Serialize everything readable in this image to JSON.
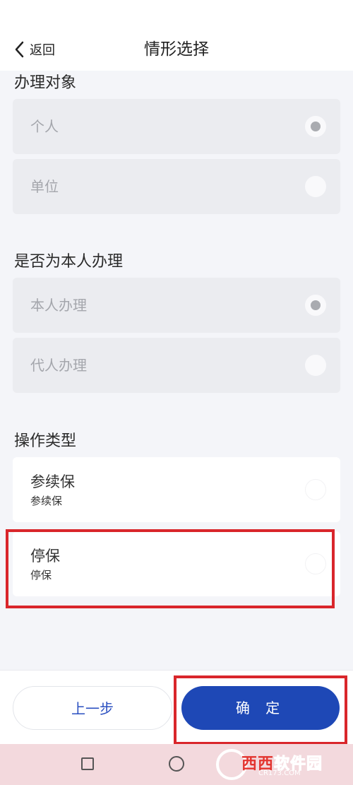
{
  "header": {
    "back_label": "返回",
    "title": "情形选择"
  },
  "sections": [
    {
      "title": "办理对象",
      "options": [
        {
          "label": "个人",
          "selected": true
        },
        {
          "label": "单位",
          "selected": false
        }
      ]
    },
    {
      "title": "是否为本人办理",
      "options": [
        {
          "label": "本人办理",
          "selected": true
        },
        {
          "label": "代人办理",
          "selected": false
        }
      ]
    },
    {
      "title": "操作类型",
      "options": [
        {
          "label": "参续保",
          "sub": "参续保",
          "selected": false
        },
        {
          "label": "停保",
          "sub": "停保",
          "selected": false
        }
      ]
    }
  ],
  "footer": {
    "prev_label": "上一步",
    "confirm_label": "确 定"
  },
  "watermark": {
    "brand_red": "西西",
    "brand_white": "软件园",
    "url": "CR173.COM"
  },
  "colors": {
    "primary": "#1e48b6",
    "highlight": "#d9262b",
    "background": "#f4f5f9"
  },
  "icons": [
    "chevron-left-icon",
    "radio-icon",
    "nav-recent-icon",
    "nav-home-icon",
    "watermark-logo"
  ]
}
